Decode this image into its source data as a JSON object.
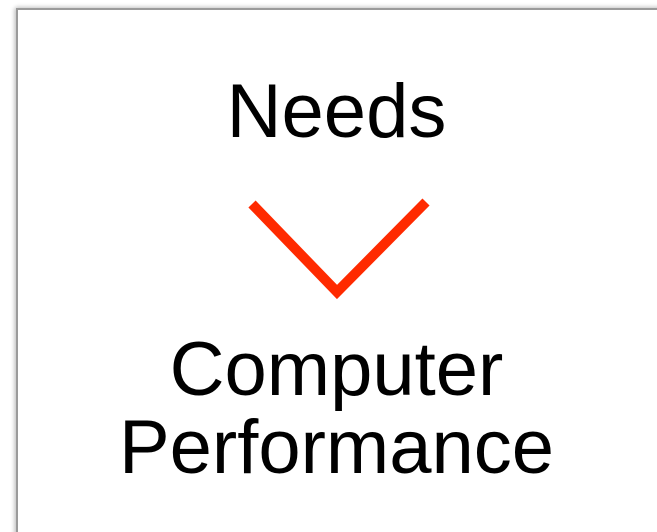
{
  "diagram": {
    "top_text": "Needs",
    "bottom_text_line1": "Computer",
    "bottom_text_line2": "Performance",
    "arrow_icon": "chevron-down-icon",
    "arrow_color": "#ff2a00"
  }
}
